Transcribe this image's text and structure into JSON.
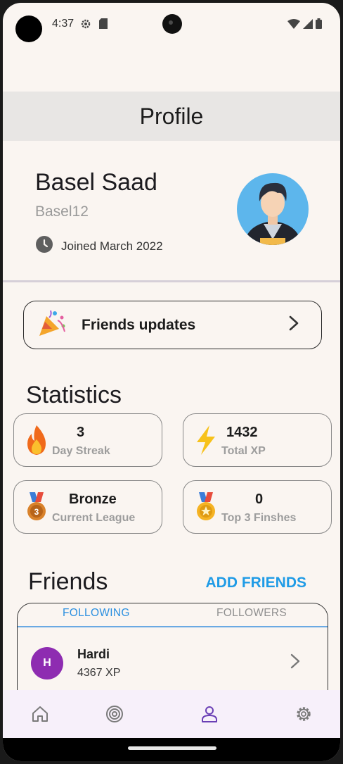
{
  "status_bar": {
    "time": "4:37",
    "icons": [
      "settings-gear-icon",
      "sd-card-icon",
      "wifi-icon",
      "signal-icon",
      "battery-icon"
    ]
  },
  "app_bar": {
    "title": "Profile"
  },
  "profile": {
    "name": "Basel Saad",
    "username": "Basel12",
    "joined": "Joined March 2022",
    "avatar_bg": "#5db6ec"
  },
  "friends_updates": {
    "label": "Friends updates",
    "icon": "party-popper-icon"
  },
  "statistics": {
    "title": "Statistics",
    "cards": [
      {
        "icon": "fire-icon",
        "value": "3",
        "label": "Day Streak"
      },
      {
        "icon": "lightning-icon",
        "value": "1432",
        "label": "Total XP"
      },
      {
        "icon": "bronze-medal-icon",
        "value": "Bronze",
        "label": "Current League"
      },
      {
        "icon": "gold-medal-icon",
        "value": "0",
        "label": "Top 3 Finshes"
      }
    ]
  },
  "friends": {
    "title": "Friends",
    "add_label": "ADD FRIENDS",
    "tabs": [
      "FOLLOWING",
      "FOLLOWERS"
    ],
    "active_tab": "FOLLOWING",
    "list": [
      {
        "initial": "H",
        "name": "Hardi",
        "xp": "4367 XP",
        "avatar_color": "#8e2cb1"
      }
    ]
  },
  "bottom_nav": {
    "items": [
      "home-icon",
      "target-icon",
      "profile-icon",
      "settings-icon"
    ],
    "active": "profile-icon",
    "active_color": "#6a3fb5"
  },
  "colors": {
    "accent": "#1f9be6",
    "background": "#faf5f1",
    "app_bar": "#e8e6e4"
  }
}
